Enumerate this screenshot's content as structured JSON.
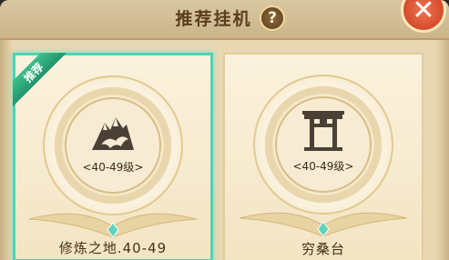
{
  "header": {
    "title": "推荐挂机",
    "help_symbol": "?",
    "close_symbol": "✕"
  },
  "colors": {
    "accent": "#4fd3b5",
    "recommend_badge": "#2aa779",
    "title": "#5b3d1f"
  },
  "cards": [
    {
      "badge": "推荐",
      "icon": "mountain-icon",
      "level": "<40-49级>",
      "name": "修炼之地.40-49"
    },
    {
      "icon": "gate-icon",
      "level": "<40-49级>",
      "name": "穷桑台"
    }
  ]
}
